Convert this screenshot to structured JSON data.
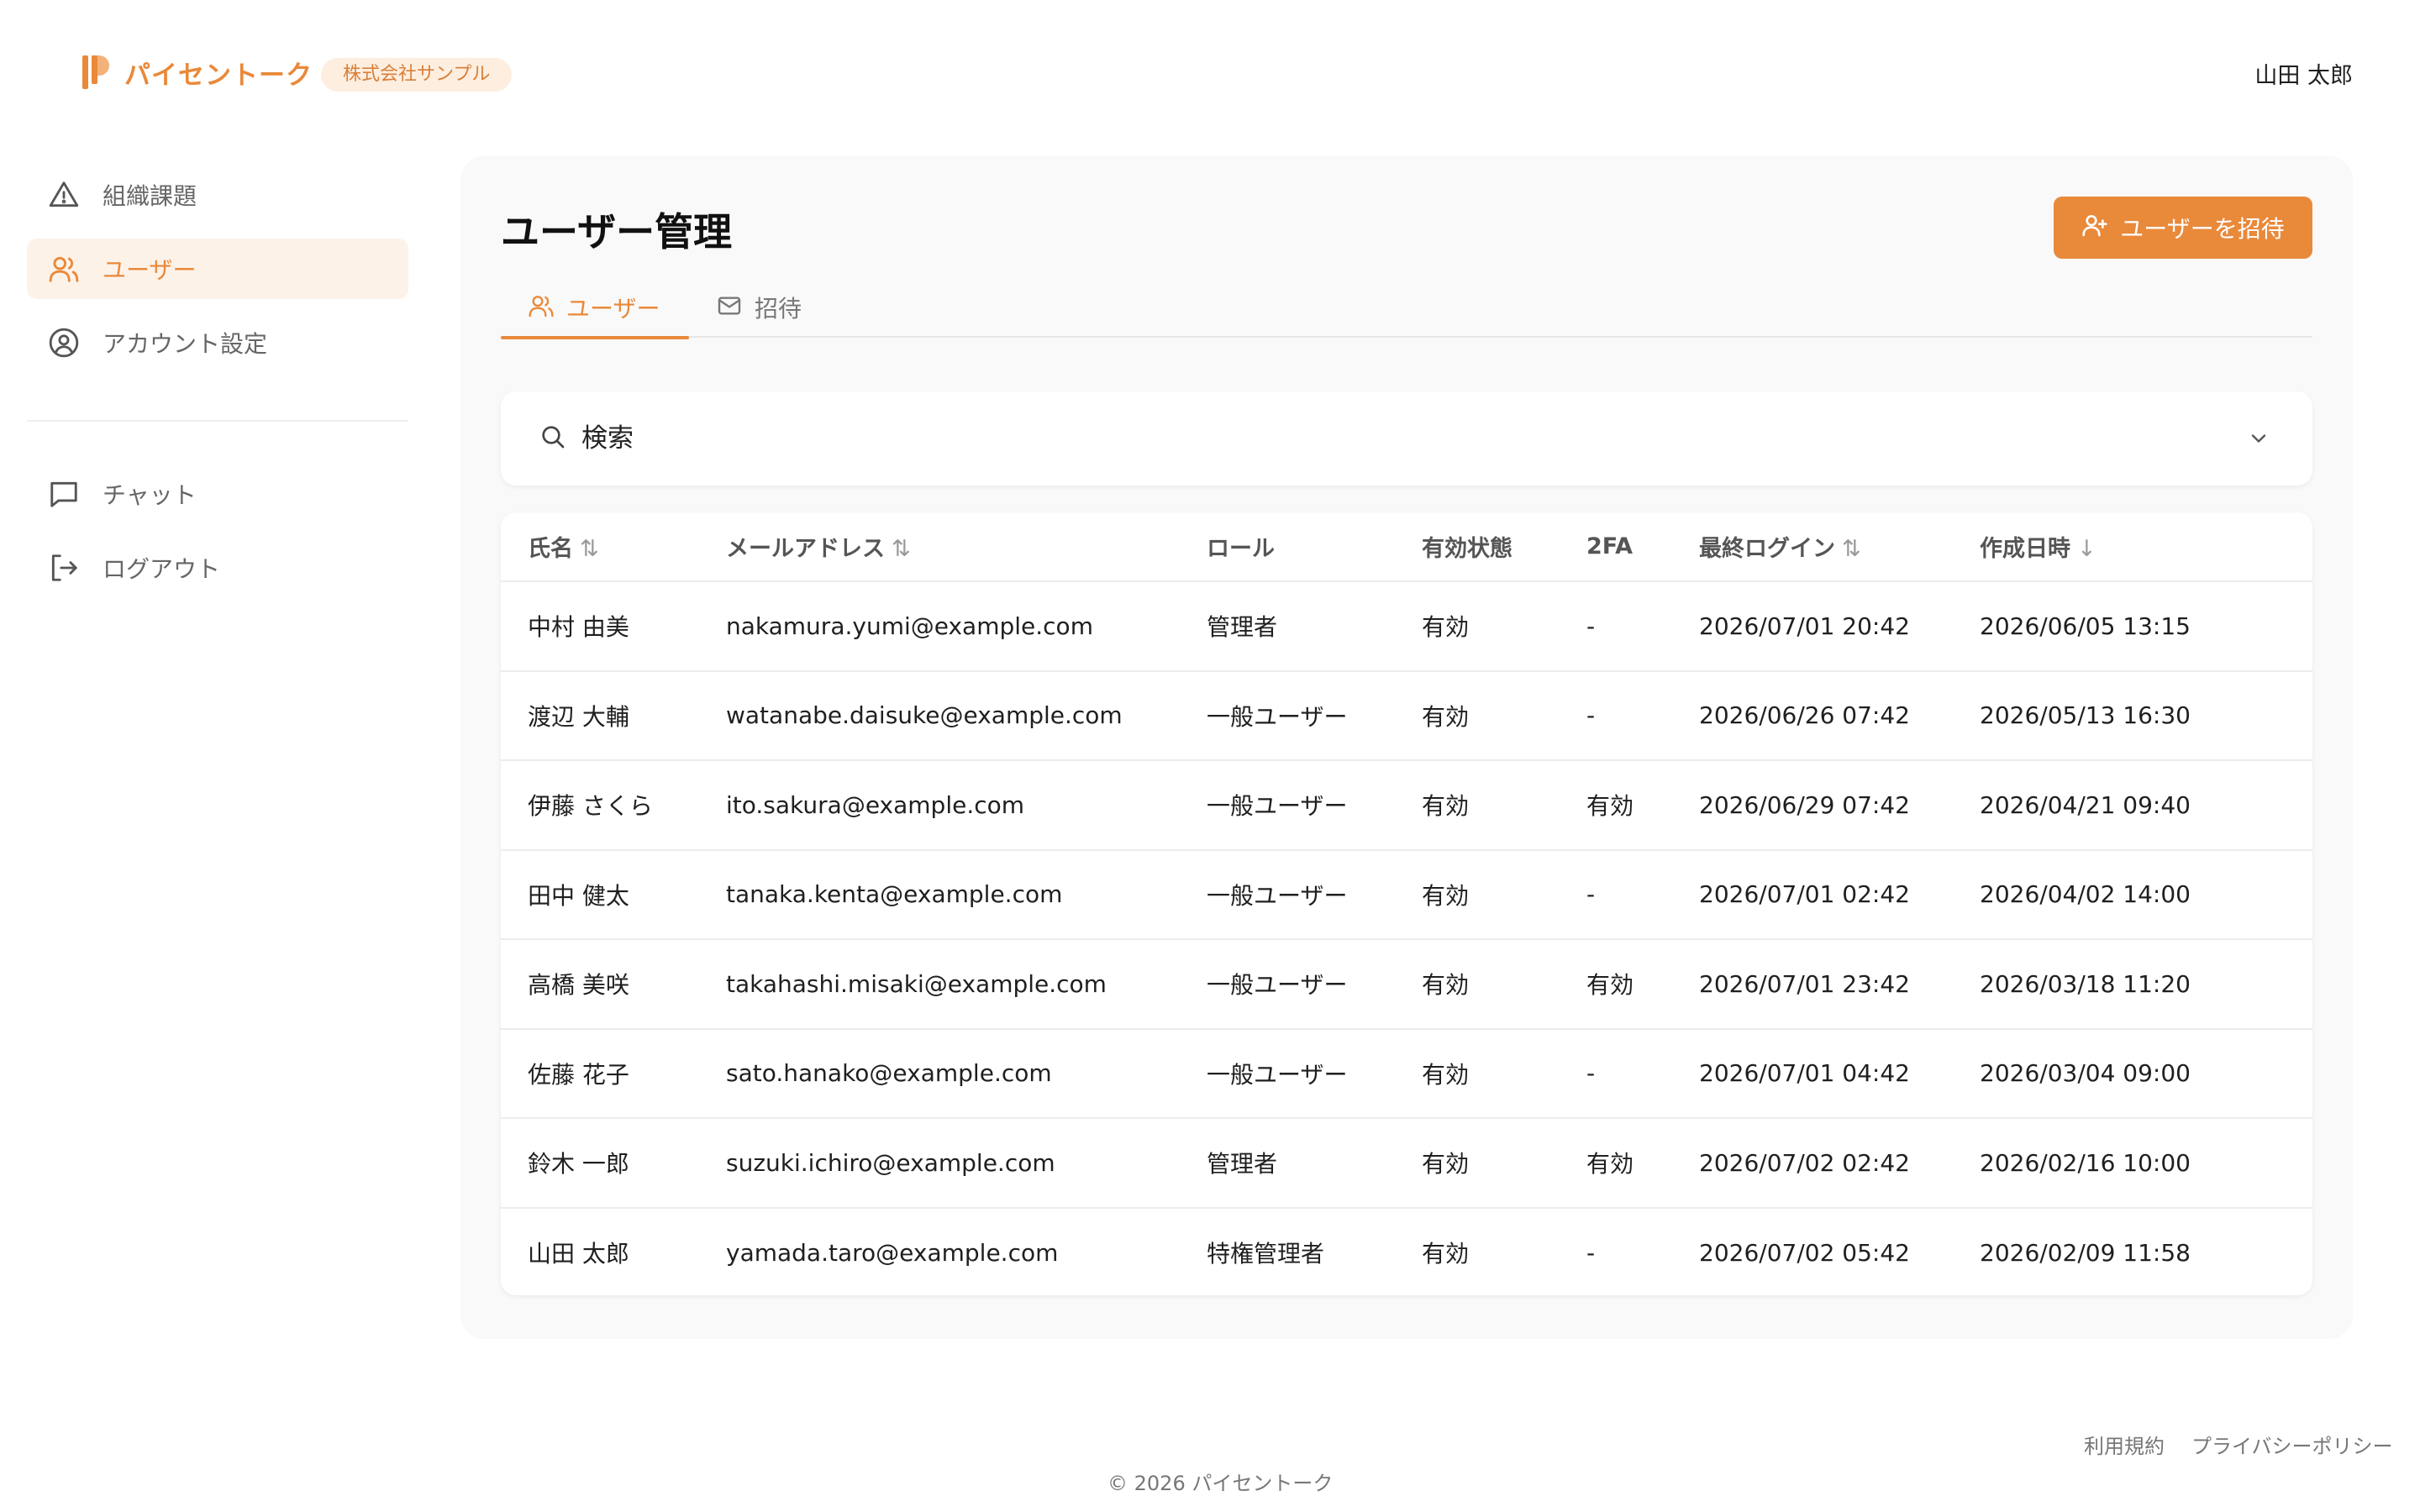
{
  "app": {
    "name": "パイセントーク",
    "organization": "株式会社サンプル",
    "current_user": "山田 太郎",
    "accent_color": "#e9893a"
  },
  "sidebar": {
    "items": [
      {
        "label": "組織課題",
        "icon": "warning-triangle-icon",
        "active": false
      },
      {
        "label": "ユーザー",
        "icon": "users-icon",
        "active": true
      },
      {
        "label": "アカウント設定",
        "icon": "user-circle-icon",
        "active": false
      },
      {
        "label": "チャット",
        "icon": "chat-bubble-icon",
        "active": false
      },
      {
        "label": "ログアウト",
        "icon": "logout-icon",
        "active": false
      }
    ]
  },
  "main": {
    "title": "ユーザー管理",
    "invite_button": "ユーザーを招待",
    "tabs": [
      {
        "label": "ユーザー",
        "icon": "users-icon",
        "active": true
      },
      {
        "label": "招待",
        "icon": "mail-icon",
        "active": false
      }
    ],
    "search": {
      "placeholder": "検索",
      "value": ""
    },
    "table": {
      "columns": [
        {
          "label": "氏名",
          "sort": "⇅"
        },
        {
          "label": "メールアドレス",
          "sort": "⇅"
        },
        {
          "label": "ロール",
          "sort": ""
        },
        {
          "label": "有効状態",
          "sort": ""
        },
        {
          "label": "2FA",
          "sort": ""
        },
        {
          "label": "最終ログイン",
          "sort": "⇅"
        },
        {
          "label": "作成日時",
          "sort": "↓"
        }
      ],
      "rows": [
        [
          "中村 由美",
          "nakamura.yumi@example.com",
          "管理者",
          "有効",
          "-",
          "2026/07/01 20:42",
          "2026/06/05 13:15"
        ],
        [
          "渡辺 大輔",
          "watanabe.daisuke@example.com",
          "一般ユーザー",
          "有効",
          "-",
          "2026/06/26 07:42",
          "2026/05/13 16:30"
        ],
        [
          "伊藤 さくら",
          "ito.sakura@example.com",
          "一般ユーザー",
          "有効",
          "有効",
          "2026/06/29 07:42",
          "2026/04/21 09:40"
        ],
        [
          "田中 健太",
          "tanaka.kenta@example.com",
          "一般ユーザー",
          "有効",
          "-",
          "2026/07/01 02:42",
          "2026/04/02 14:00"
        ],
        [
          "高橋 美咲",
          "takahashi.misaki@example.com",
          "一般ユーザー",
          "有効",
          "有効",
          "2026/07/01 23:42",
          "2026/03/18 11:20"
        ],
        [
          "佐藤 花子",
          "sato.hanako@example.com",
          "一般ユーザー",
          "有効",
          "-",
          "2026/07/01 04:42",
          "2026/03/04 09:00"
        ],
        [
          "鈴木 一郎",
          "suzuki.ichiro@example.com",
          "管理者",
          "有効",
          "有効",
          "2026/07/02 02:42",
          "2026/02/16 10:00"
        ],
        [
          "山田 太郎",
          "yamada.taro@example.com",
          "特権管理者",
          "有効",
          "-",
          "2026/07/02 05:42",
          "2026/02/09 11:58"
        ]
      ]
    }
  },
  "footer": {
    "links": [
      "利用規約",
      "プライバシーポリシー"
    ],
    "copyright": "© 2026 パイセントーク"
  }
}
